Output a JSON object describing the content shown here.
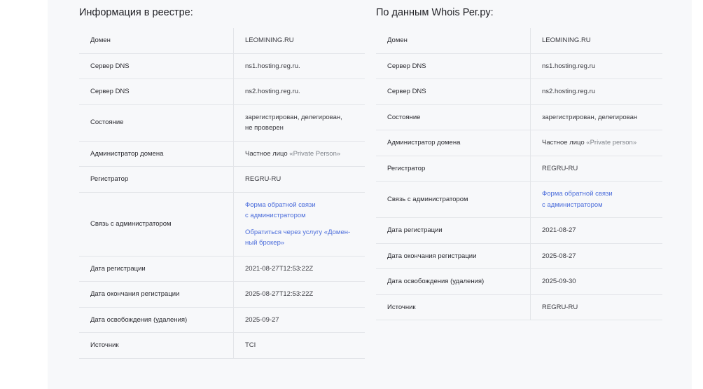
{
  "left": {
    "title": "Информация в реестре:",
    "rows": [
      {
        "label": "Домен",
        "value": "LEOMINING.RU"
      },
      {
        "label": "Сервер DNS",
        "value": "ns1.hosting.reg.ru."
      },
      {
        "label": "Сервер DNS",
        "value": "ns2.hosting.reg.ru."
      },
      {
        "label": "Состояние",
        "value_lines": [
          "зарегистрирован, делегирован,",
          "не проверен"
        ]
      },
      {
        "label": "Администратор домена",
        "value_prefix": "Частное лицо ",
        "value_quoted": "«Private Person»"
      },
      {
        "label": "Регистратор",
        "value": "REGRU-RU"
      },
      {
        "label": "Связь с администратором",
        "links": [
          [
            "Форма обратной связи",
            "с администратором"
          ],
          [
            "Обратиться через услугу «Домен-",
            "ный брокер»"
          ]
        ]
      },
      {
        "label": "Дата регистрации",
        "value": "2021-08-27T12:53:22Z"
      },
      {
        "label": "Дата окончания регистрации",
        "value": "2025-08-27T12:53:22Z"
      },
      {
        "label": "Дата освобождения (удаления)",
        "value": "2025-09-27"
      },
      {
        "label": "Источник",
        "value": "TCI"
      }
    ]
  },
  "right": {
    "title": "По данным Whois Рег.ру:",
    "rows": [
      {
        "label": "Домен",
        "value": "LEOMINING.RU"
      },
      {
        "label": "Сервер DNS",
        "value": "ns1.hosting.reg.ru"
      },
      {
        "label": "Сервер DNS",
        "value": "ns2.hosting.reg.ru"
      },
      {
        "label": "Состояние",
        "value": "зарегистрирован, делегирован"
      },
      {
        "label": "Администратор домена",
        "value_prefix": "Частное лицо ",
        "value_quoted": "«Private person»"
      },
      {
        "label": "Регистратор",
        "value": "REGRU-RU"
      },
      {
        "label": "Связь с администратором",
        "links": [
          [
            "Форма обратной связи",
            "с администратором"
          ]
        ]
      },
      {
        "label": "Дата регистрации",
        "value": "2021-08-27"
      },
      {
        "label": "Дата окончания регистрации",
        "value": "2025-08-27"
      },
      {
        "label": "Дата освобождения (удаления)",
        "value": "2025-09-30"
      },
      {
        "label": "Источник",
        "value": "REGRU-RU"
      }
    ]
  }
}
